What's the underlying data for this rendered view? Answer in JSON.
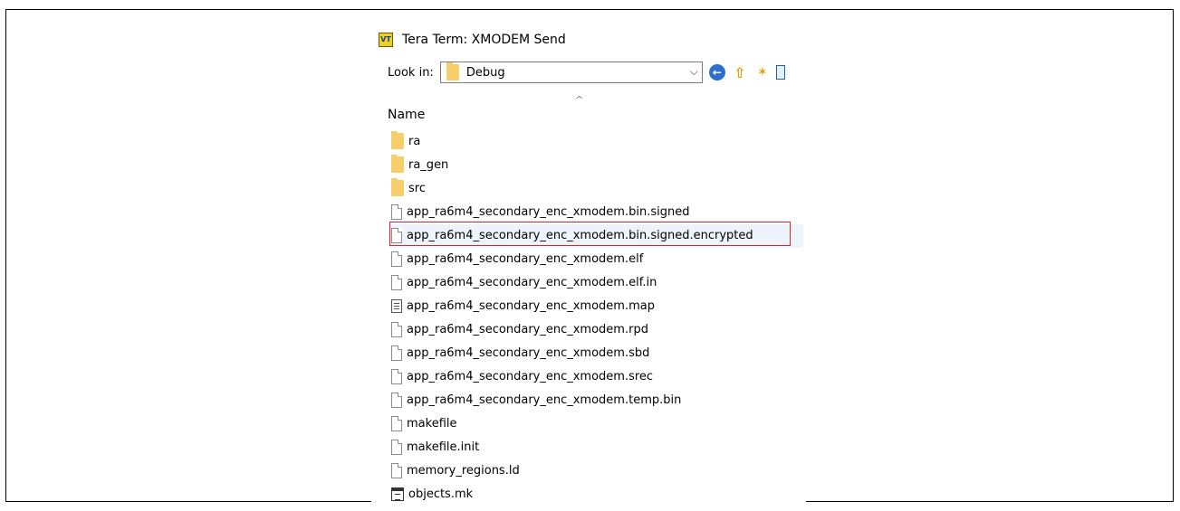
{
  "window": {
    "title": "Tera Term: XMODEM Send",
    "app_icon_text": "VT"
  },
  "toolbar": {
    "look_in_label": "Look in:",
    "look_in_value": "Debug",
    "icons": [
      "back-icon",
      "up-folder-icon",
      "new-folder-icon",
      "view-menu-icon"
    ]
  },
  "list": {
    "column_header": "Name",
    "sort_indicator": "^",
    "highlight_color": "#d9262b",
    "items": [
      {
        "name": "ra",
        "type": "folder"
      },
      {
        "name": "ra_gen",
        "type": "folder"
      },
      {
        "name": "src",
        "type": "folder"
      },
      {
        "name": "app_ra6m4_secondary_enc_xmodem.bin.signed",
        "type": "file"
      },
      {
        "name": "app_ra6m4_secondary_enc_xmodem.bin.signed.encrypted",
        "type": "file",
        "selected": true
      },
      {
        "name": "app_ra6m4_secondary_enc_xmodem.elf",
        "type": "file"
      },
      {
        "name": "app_ra6m4_secondary_enc_xmodem.elf.in",
        "type": "file"
      },
      {
        "name": "app_ra6m4_secondary_enc_xmodem.map",
        "type": "text-file"
      },
      {
        "name": "app_ra6m4_secondary_enc_xmodem.rpd",
        "type": "file"
      },
      {
        "name": "app_ra6m4_secondary_enc_xmodem.sbd",
        "type": "file"
      },
      {
        "name": "app_ra6m4_secondary_enc_xmodem.srec",
        "type": "file"
      },
      {
        "name": "app_ra6m4_secondary_enc_xmodem.temp.bin",
        "type": "file"
      },
      {
        "name": "makefile",
        "type": "file"
      },
      {
        "name": "makefile.init",
        "type": "file"
      },
      {
        "name": "memory_regions.ld",
        "type": "file"
      },
      {
        "name": "objects.mk",
        "type": "makefile-file"
      }
    ]
  }
}
